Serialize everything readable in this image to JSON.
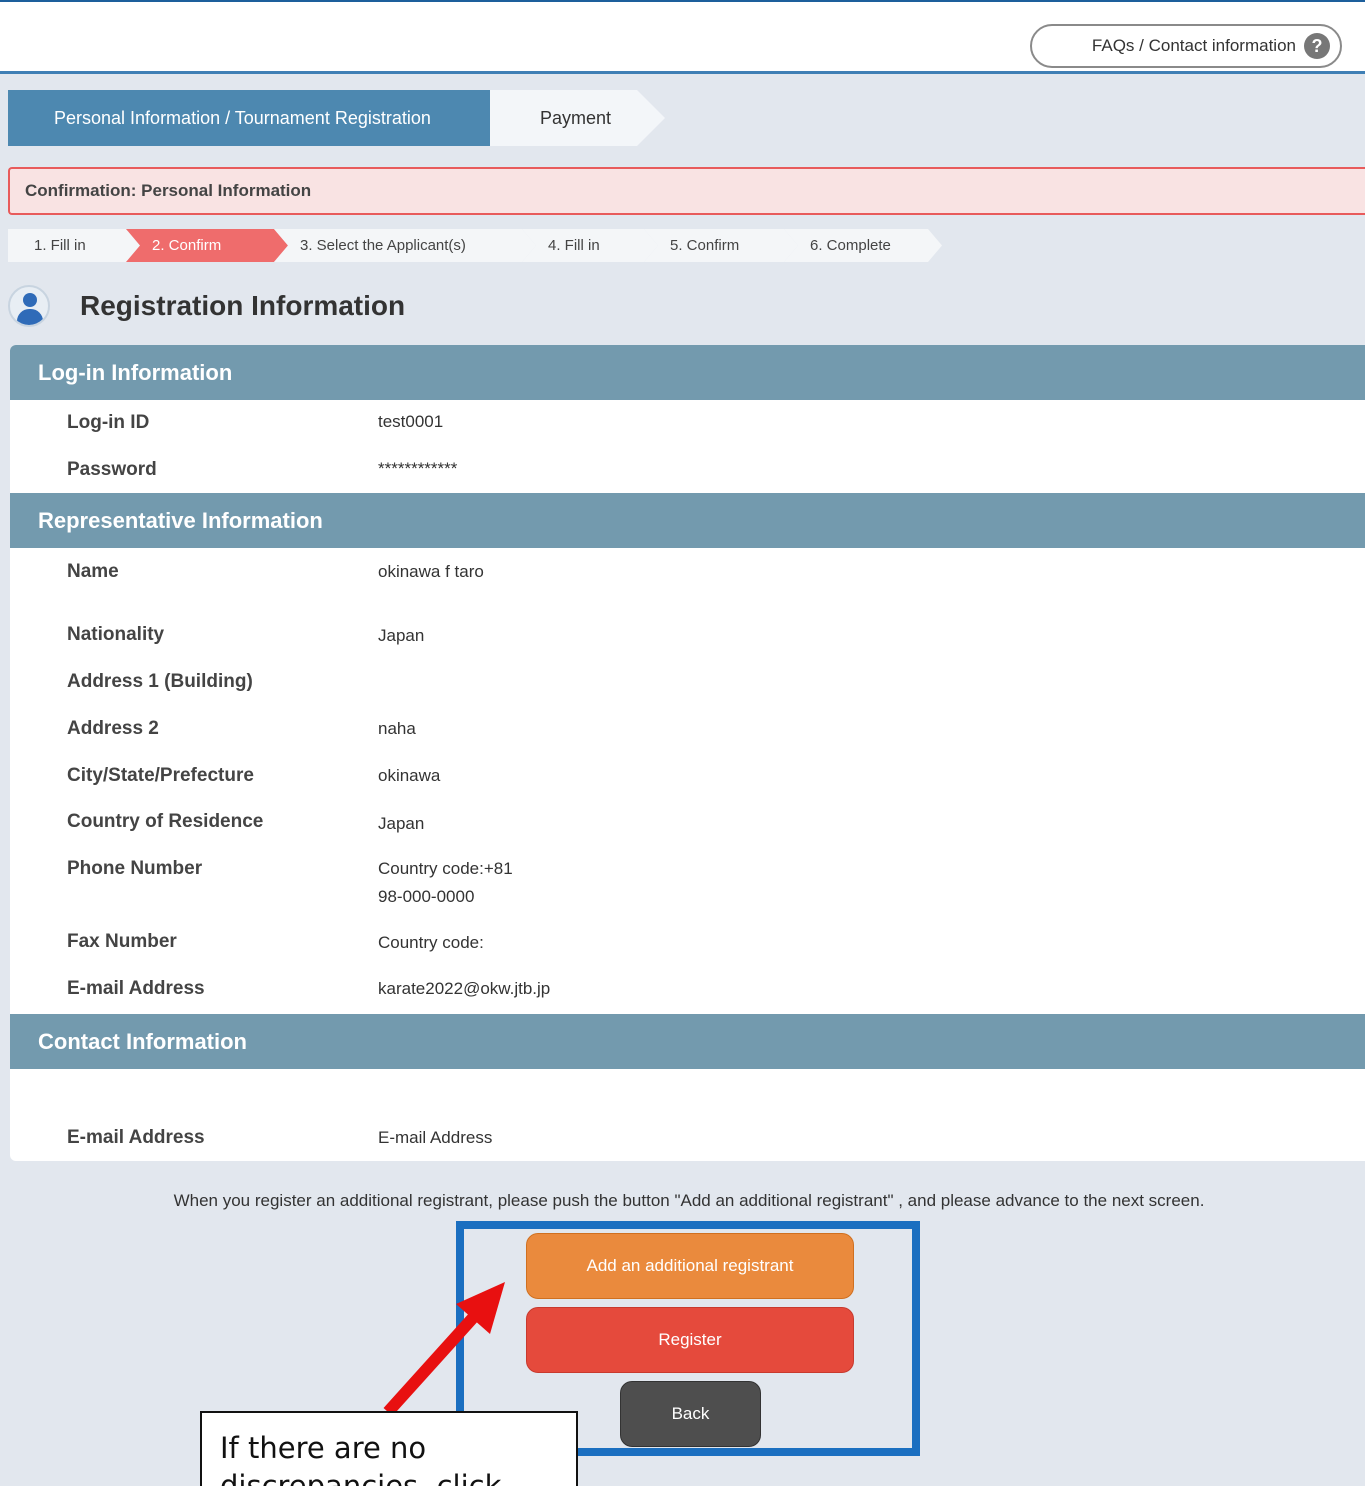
{
  "header": {
    "faq_label": "FAQs / Contact information",
    "faq_icon": "question-icon"
  },
  "major_steps": [
    {
      "label": "Personal Information / Tournament Registration",
      "active": true
    },
    {
      "label": "Payment",
      "active": false
    }
  ],
  "confirmation_banner": "Confirmation: Personal Information",
  "sub_steps": [
    {
      "label": "1.  Fill in",
      "active": false
    },
    {
      "label": "2.  Confirm",
      "active": true
    },
    {
      "label": "3.  Select the Applicant(s)",
      "active": false
    },
    {
      "label": "4.  Fill in",
      "active": false
    },
    {
      "label": "5.  Confirm",
      "active": false
    },
    {
      "label": "6.  Complete",
      "active": false
    }
  ],
  "page_title": "Registration Information",
  "sections": {
    "login": {
      "title": "Log-in Information",
      "rows": [
        {
          "label": "Log-in ID",
          "value": "test0001"
        },
        {
          "label": "Password",
          "value": "************"
        }
      ]
    },
    "representative": {
      "title": "Representative Information",
      "rows": [
        {
          "label": "Name",
          "value": "okinawa f taro"
        },
        {
          "label": "Nationality",
          "value": "Japan"
        },
        {
          "label": "Address 1 (Building)",
          "value": ""
        },
        {
          "label": "Address 2",
          "value": "naha"
        },
        {
          "label": "City/State/Prefecture",
          "value": "okinawa"
        },
        {
          "label": "Country of Residence",
          "value": "Japan"
        },
        {
          "label": "Phone Number",
          "value": "Country code:+81",
          "value2": "98-000-0000"
        },
        {
          "label": "Fax Number",
          "value": "Country code:"
        },
        {
          "label": "E-mail Address",
          "value": "karate2022@okw.jtb.jp"
        }
      ]
    },
    "contact": {
      "title": "Contact Information",
      "rows": [
        {
          "label": "E-mail Address",
          "value": "E-mail Address"
        }
      ]
    }
  },
  "notice": "When you register an additional registrant, please push the button \"Add an additional registrant\" , and please advance to the next screen.",
  "buttons": {
    "add": "Add an additional registrant",
    "register": "Register",
    "back": "Back"
  },
  "callout": {
    "line1": "If there are no",
    "line2": "discrepancies, click"
  },
  "colors": {
    "section_header": "#739aae",
    "active_step": "#4d88b0",
    "confirm_step": "#ef6c6c",
    "add_button": "#ea8a3d",
    "register_button": "#e54a3c",
    "back_button": "#4e4e4e",
    "highlight_frame": "#1b6fc0",
    "arrow": "#e81010"
  }
}
